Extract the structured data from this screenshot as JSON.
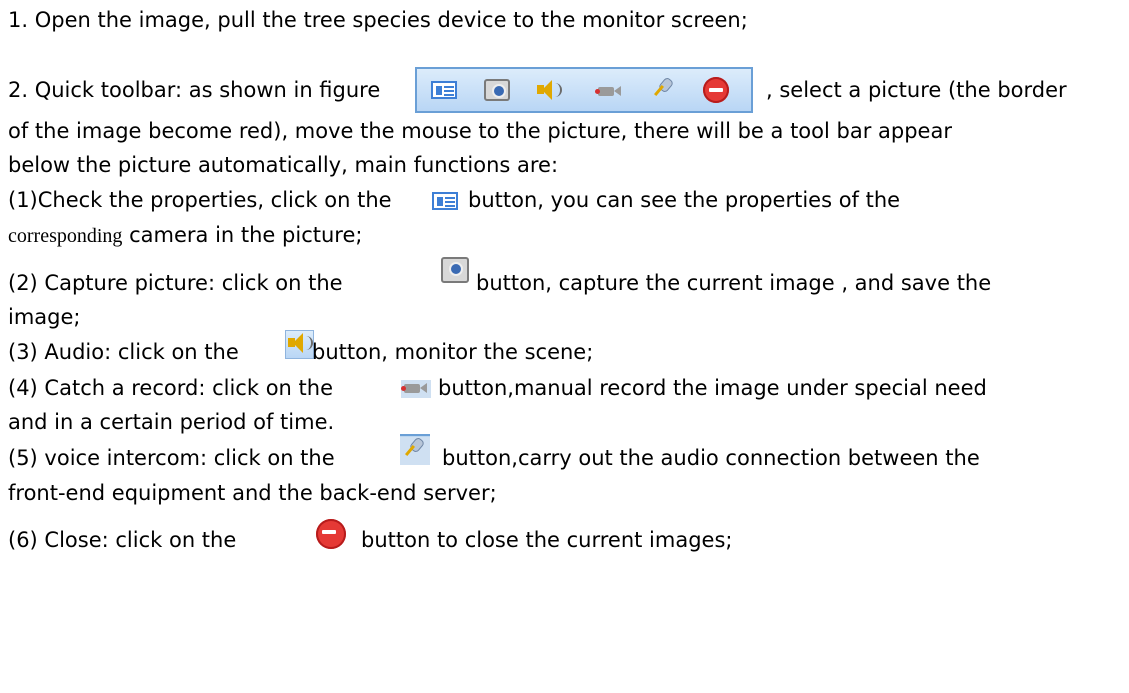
{
  "lines": {
    "l1": "1. Open the image, pull the tree species device to the monitor screen;",
    "l2a": "2. Quick toolbar: as shown in figure",
    "l2b": ", select a picture (the border",
    "l3": "of the image become red), move the mouse to the picture, there will be a tool bar appear",
    "l4": "below the picture automatically, main functions are:",
    "l5a": "(1)Check the properties, click on the",
    "l5b": "button, you can see the properties of the",
    "l6a": "corresponding",
    "l6b": " camera in the picture;",
    "l7a": "(2) Capture picture: click on the",
    "l7b": "button, capture the current image , and save the",
    "l8": "image;",
    "l9a": "(3) Audio: click on the",
    "l9b": " button, monitor the scene;",
    "l10a": "(4) Catch a record: click on the",
    "l10b": "button,manual record the image under special need",
    "l11": "and in a certain period of time.",
    "l12a": "(5) voice intercom: click on the",
    "l12b": "button,carry out the audio connection between   the",
    "l13": "front-end equipment and the back-end server;",
    "l14a": "(6) Close: click on the",
    "l14b": "button to close the current images;"
  },
  "icons": [
    "properties-icon",
    "camera-icon",
    "speaker-icon",
    "video-record-icon",
    "microphone-icon",
    "close-icon"
  ]
}
